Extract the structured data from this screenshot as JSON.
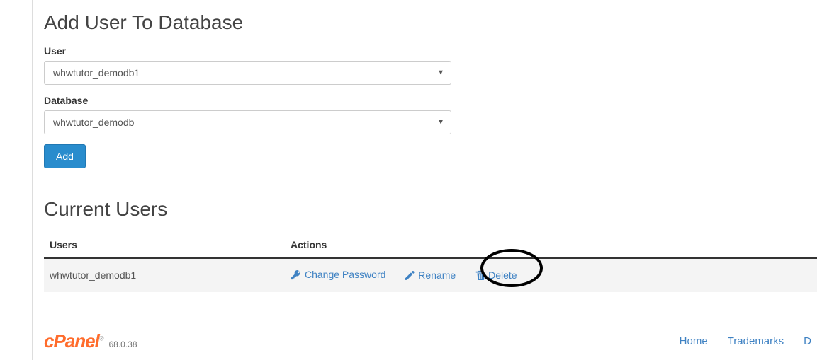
{
  "addUser": {
    "heading": "Add User To Database",
    "userLabel": "User",
    "userValue": "whwtutor_demodb1",
    "databaseLabel": "Database",
    "databaseValue": "whwtutor_demodb",
    "addButton": "Add"
  },
  "currentUsers": {
    "heading": "Current Users",
    "columns": {
      "users": "Users",
      "actions": "Actions"
    },
    "rows": [
      {
        "username": "whwtutor_demodb1",
        "actions": {
          "changePassword": "Change Password",
          "rename": "Rename",
          "delete": "Delete"
        }
      }
    ]
  },
  "footer": {
    "logo": "cPanel",
    "version": "68.0.38",
    "links": {
      "home": "Home",
      "trademarks": "Trademarks",
      "docs": "D"
    }
  }
}
